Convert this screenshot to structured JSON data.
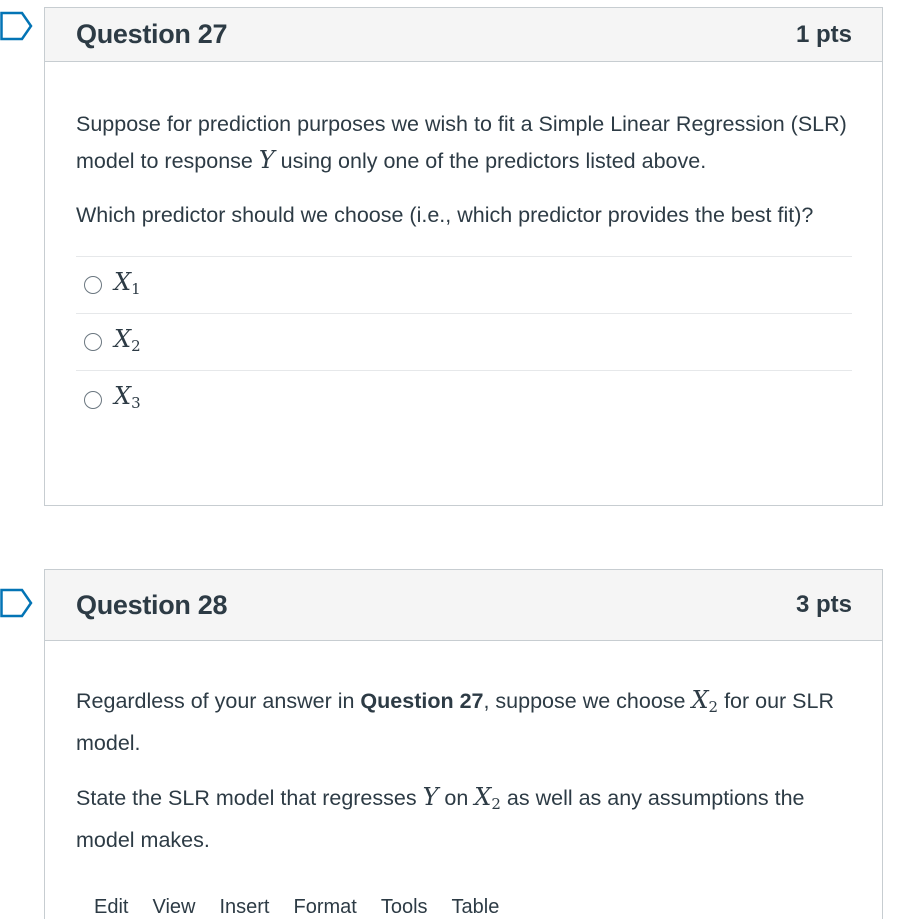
{
  "q27": {
    "title": "Question 27",
    "points": "1 pts",
    "para1_a": "Suppose for prediction purposes we wish to fit a Simple Linear Regression (SLR) model to response ",
    "para1_var": "Y",
    "para1_b": " using only one of the predictors listed above.",
    "para2": "Which predictor should we choose (i.e., which predictor provides the best fit)?",
    "options": [
      {
        "var": "X",
        "sub": "1"
      },
      {
        "var": "X",
        "sub": "2"
      },
      {
        "var": "X",
        "sub": "3"
      }
    ]
  },
  "q28": {
    "title": "Question 28",
    "points": "3 pts",
    "para1_a": "Regardless of your answer in ",
    "para1_bold": "Question 27",
    "para1_b": ", suppose we choose ",
    "para1_var": "X",
    "para1_sub": "2",
    "para1_c": " for our SLR model.",
    "para2_a": "State the SLR model that regresses ",
    "para2_var1": "Y",
    "para2_b": " on ",
    "para2_var2": "X",
    "para2_sub2": "2",
    "para2_c": " as well as any assumptions the model makes."
  },
  "toolbar": {
    "items": [
      "Edit",
      "View",
      "Insert",
      "Format",
      "Tools",
      "Table"
    ]
  },
  "colors": {
    "bookmark": "#0374b5",
    "border": "#c7cdd1",
    "header_bg": "#f5f5f5",
    "text": "#2d3b45"
  }
}
